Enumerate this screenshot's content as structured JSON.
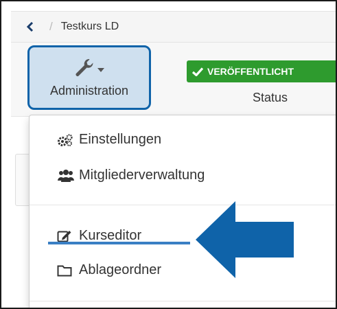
{
  "breadcrumb": {
    "back_icon": "chevron-left-icon",
    "separator": "/",
    "course": "Testkurs LD"
  },
  "toolbar": {
    "administration": {
      "icon": "wrench-icon",
      "caret_icon": "caret-down-icon",
      "label": "Administration"
    },
    "status": {
      "badge_icon": "check-icon",
      "badge_text": "VERÖFFENTLICHT",
      "label": "Status"
    }
  },
  "menu": {
    "items": [
      {
        "icon": "cogs-icon",
        "label": "Einstellungen"
      },
      {
        "icon": "users-icon",
        "label": "Mitgliederverwaltung"
      },
      {
        "icon": "edit-icon",
        "label": "Kurseditor"
      },
      {
        "icon": "folder-icon",
        "label": "Ablageordner"
      }
    ]
  },
  "annotation": {
    "arrow_icon": "arrow-left-icon",
    "color": "#0f63a9"
  },
  "colors": {
    "accent": "#0f63a9",
    "status_green": "#2e9b2e",
    "highlight_bg": "#cfe0ef"
  }
}
